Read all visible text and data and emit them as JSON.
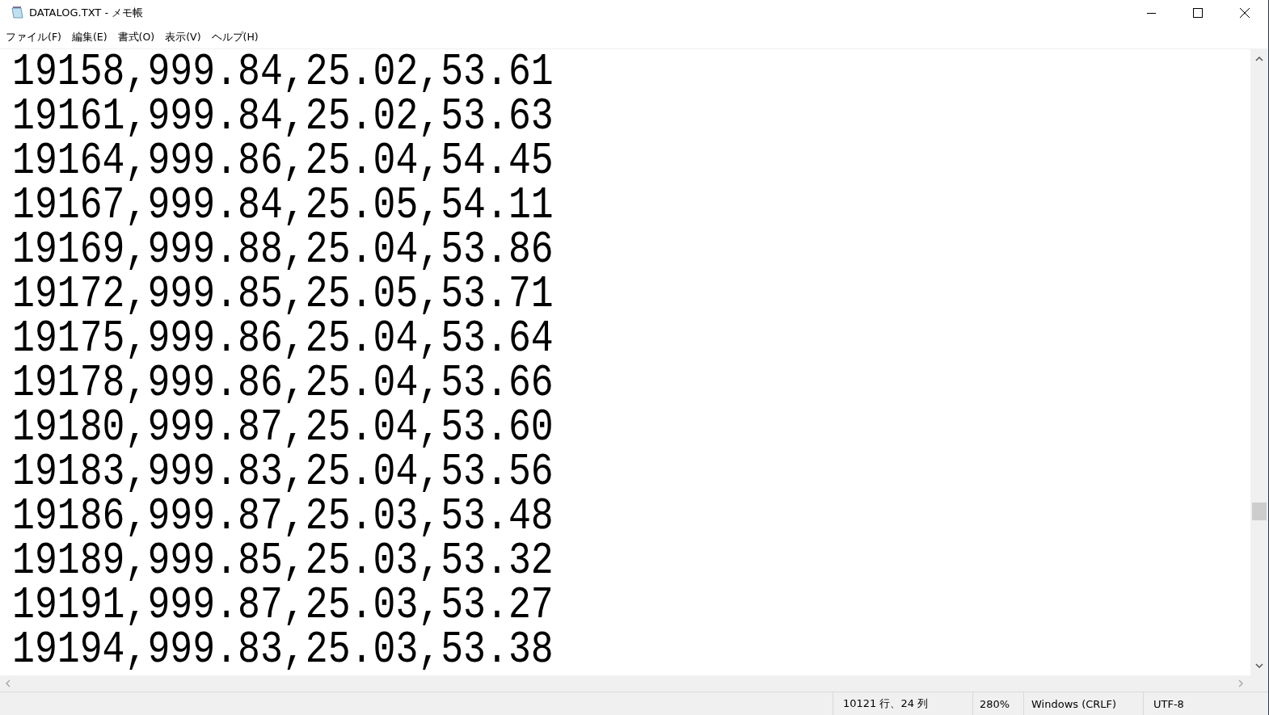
{
  "window": {
    "title": "DATALOG.TXT - メモ帳"
  },
  "menu": [
    "ファイル(F)",
    "編集(E)",
    "書式(O)",
    "表示(V)",
    "ヘルプ(H)"
  ],
  "lines": [
    "19158,999.84,25.02,53.61",
    "19161,999.84,25.02,53.63",
    "19164,999.86,25.04,54.45",
    "19167,999.84,25.05,54.11",
    "19169,999.88,25.04,53.86",
    "19172,999.85,25.05,53.71",
    "19175,999.86,25.04,53.64",
    "19178,999.86,25.04,53.66",
    "19180,999.87,25.04,53.60",
    "19183,999.83,25.04,53.56",
    "19186,999.87,25.03,53.48",
    "19189,999.85,25.03,53.32",
    "19191,999.87,25.03,53.27",
    "19194,999.83,25.03,53.38"
  ],
  "status_bar": [
    "10121 行、24 列",
    "280%",
    "Windows (CRLF)",
    "UTF-8"
  ]
}
